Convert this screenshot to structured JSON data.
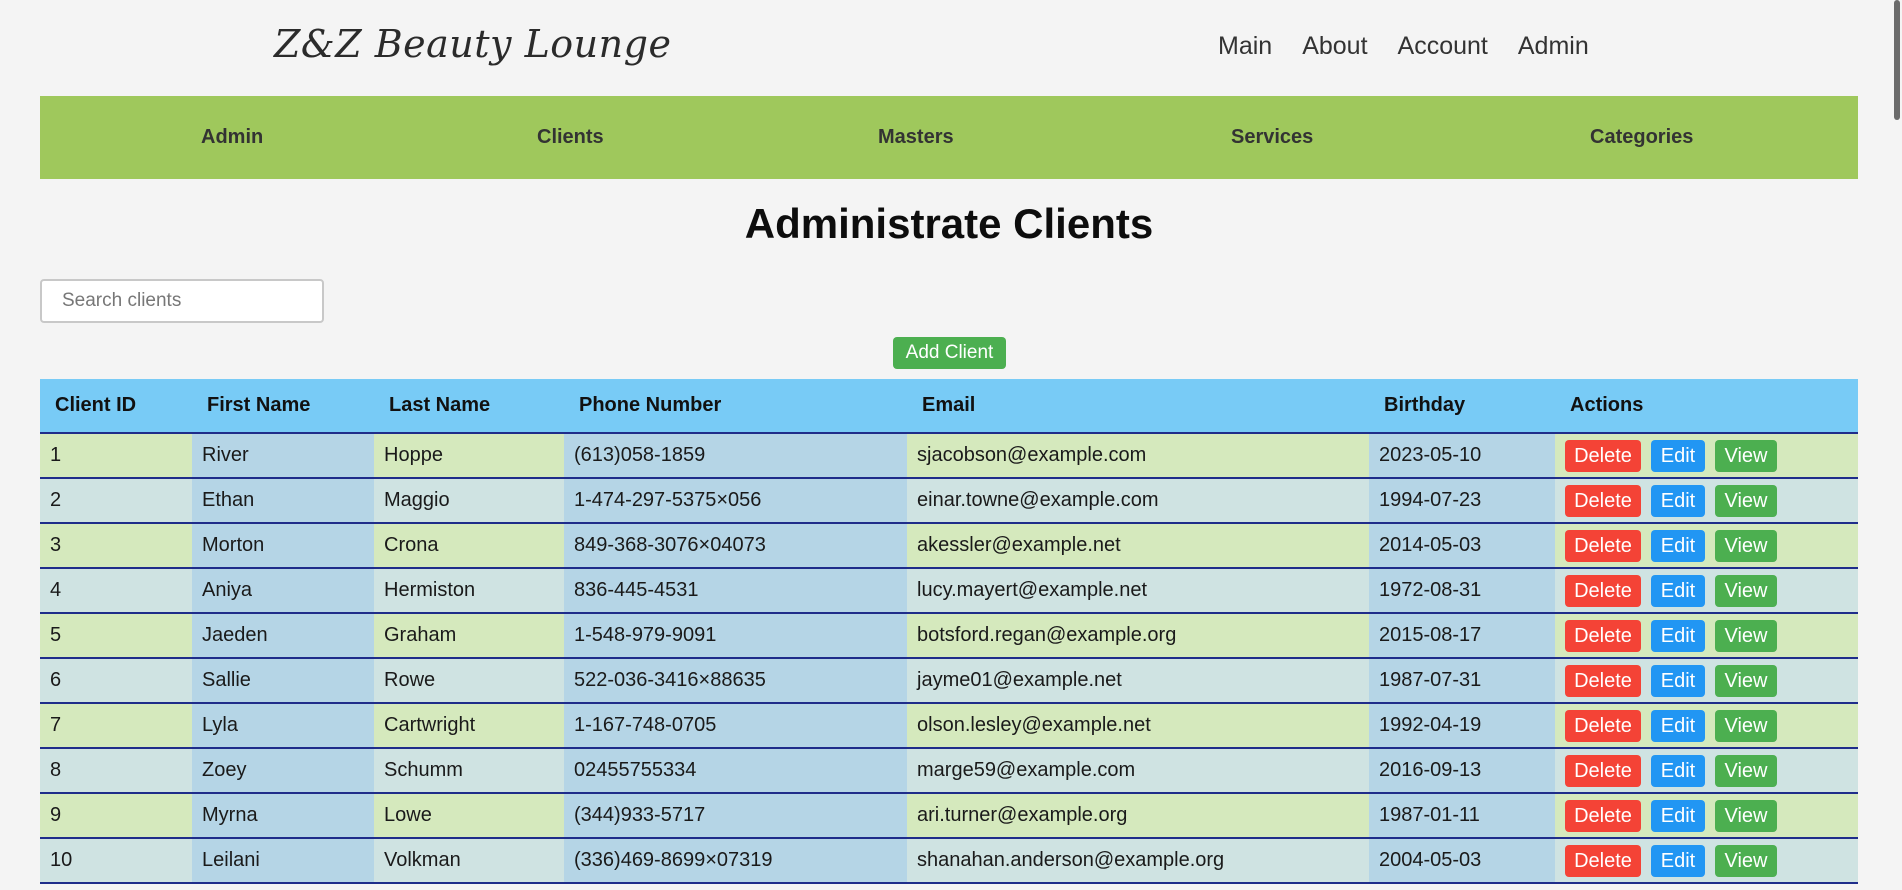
{
  "header": {
    "logo": "Z&Z Beauty Lounge",
    "nav": [
      "Main",
      "About",
      "Account",
      "Admin"
    ]
  },
  "admin_nav": [
    "Admin",
    "Clients",
    "Masters",
    "Services",
    "Categories"
  ],
  "page": {
    "title": "Administrate Clients",
    "search_placeholder": "Search clients",
    "search_value": "",
    "add_label": "Add Client"
  },
  "table": {
    "headers": [
      "Client ID",
      "First Name",
      "Last Name",
      "Phone Number",
      "Email",
      "Birthday",
      "Actions"
    ],
    "action_labels": {
      "delete": "Delete",
      "edit": "Edit",
      "view": "View"
    },
    "rows": [
      [
        "1",
        "River",
        "Hoppe",
        "(613)058-1859",
        "sjacobson@example.com",
        "2023-05-10"
      ],
      [
        "2",
        "Ethan",
        "Maggio",
        "1-474-297-5375×056",
        "einar.towne@example.com",
        "1994-07-23"
      ],
      [
        "3",
        "Morton",
        "Crona",
        "849-368-3076×04073",
        "akessler@example.net",
        "2014-05-03"
      ],
      [
        "4",
        "Aniya",
        "Hermiston",
        "836-445-4531",
        "lucy.mayert@example.net",
        "1972-08-31"
      ],
      [
        "5",
        "Jaeden",
        "Graham",
        "1-548-979-9091",
        "botsford.regan@example.org",
        "2015-08-17"
      ],
      [
        "6",
        "Sallie",
        "Rowe",
        "522-036-3416×88635",
        "jayme01@example.net",
        "1987-07-31"
      ],
      [
        "7",
        "Lyla",
        "Cartwright",
        "1-167-748-0705",
        "olson.lesley@example.net",
        "1992-04-19"
      ],
      [
        "8",
        "Zoey",
        "Schumm",
        "02455755334",
        "marge59@example.com",
        "2016-09-13"
      ],
      [
        "9",
        "Myrna",
        "Lowe",
        "(344)933-5717",
        "ari.turner@example.org",
        "1987-01-11"
      ],
      [
        "10",
        "Leilani",
        "Volkman",
        "(336)469-8699×07319",
        "shanahan.anderson@example.org",
        "2004-05-03"
      ]
    ]
  },
  "colors": {
    "admin_nav_bg": "#9fc85c",
    "table_header_bg": "#78cbf6",
    "delete": "#f44336",
    "edit": "#2196f3",
    "view": "#4caf50"
  }
}
